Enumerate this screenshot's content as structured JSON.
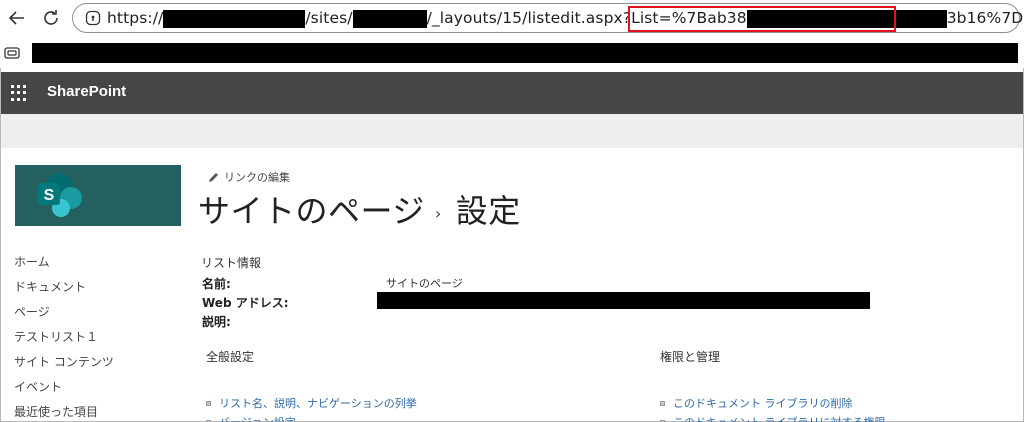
{
  "browser": {
    "url_parts": [
      "https://",
      "/sites/",
      "/_layouts/15/listedit.aspx?List=%7Bab38",
      "3b16%7D"
    ]
  },
  "suite": {
    "app_name": "SharePoint"
  },
  "left_nav": {
    "items": [
      "ホーム",
      "ドキュメント",
      "ページ",
      "テストリスト１",
      "サイト コンテンツ",
      "イベント",
      "最近使った項目"
    ]
  },
  "main": {
    "edit_links_label": "リンクの編集",
    "title_part1": "サイトのページ",
    "title_sep": "›",
    "title_part2": "設定",
    "list_info_label": "リスト情報",
    "name_label": "名前:",
    "name_value": "サイトのページ",
    "web_address_label": "Web アドレス:",
    "description_label": "説明:",
    "general_settings_label": "全般設定",
    "permissions_label": "権限と管理",
    "general_links": [
      "リスト名、説明、ナビゲーションの列挙",
      "バージョン設定"
    ],
    "permission_links": [
      "このドキュメント ライブラリの削除",
      "このドキュメント ライブラリに対する権限"
    ]
  },
  "colors": {
    "suite_bar": "#484644",
    "logo_bg": "#23605f",
    "link": "#2d6aa7",
    "highlight": "#e0141e"
  }
}
